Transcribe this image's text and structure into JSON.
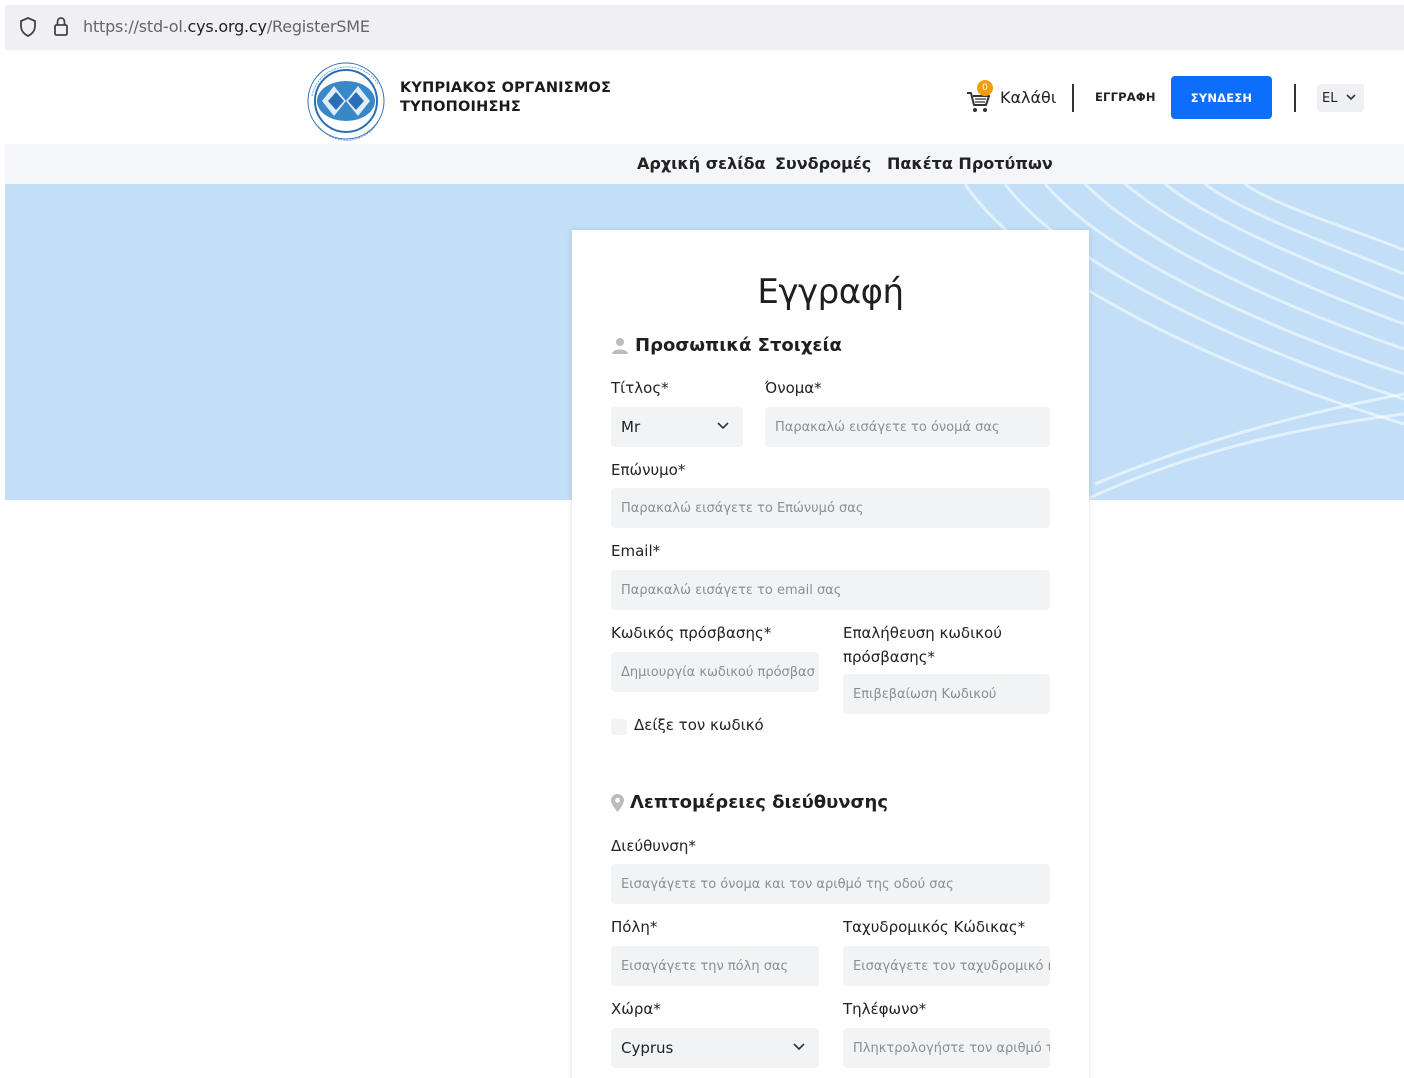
{
  "browser": {
    "url_prefix": "https://std-ol.",
    "url_domain": "cys.org.cy",
    "url_path": "/RegisterSME"
  },
  "header": {
    "brand_line1": "ΚΥΠΡΙΑΚΟΣ ΟΡΓΑΝΙΣΜΟΣ",
    "brand_line2": "ΤΥΠΟΠΟΙΗΣΗΣ",
    "cart_count": "0",
    "cart_label": "Καλάθι",
    "register_label": "ΕΓΓΡΑΦΗ",
    "login_label": "ΣΥΝΔΕΣΗ",
    "language": "EL"
  },
  "nav": {
    "items": [
      "Αρχική σελίδα",
      "Συνδρομές",
      "Πακέτα Προτύπων"
    ]
  },
  "form": {
    "title": "Εγγραφή",
    "personal_section": "Προσωπικά Στοιχεία",
    "title_label": "Τίτλος*",
    "title_value": "Mr",
    "first_name_label": "Όνομα*",
    "first_name_placeholder": "Παρακαλώ εισάγετε το όνομά σας",
    "last_name_label": "Επώνυμο*",
    "last_name_placeholder": "Παρακαλώ εισάγετε το Επώνυμό σας",
    "email_label": "Email*",
    "email_placeholder": "Παρακαλώ εισάγετε το email σας",
    "password_label": "Κωδικός πρόσβασης*",
    "password_placeholder": "Δημιουργία κωδικού πρόσβασ",
    "confirm_label": "Επαλήθευση κωδικού πρόσβασης*",
    "confirm_placeholder": "Επιβεβαίωση Κωδικού",
    "show_password_label": "Δείξε τον κωδικό",
    "address_section": "Λεπτομέρειες διεύθυνσης",
    "address_label": "Διεύθυνση*",
    "address_placeholder": "Εισαγάγετε το όνομα και τον αριθμό της οδού σας",
    "city_label": "Πόλη*",
    "city_placeholder": "Εισαγάγετε την πόλη σας",
    "postal_label": "Ταχυδρομικός Κώδικας*",
    "postal_placeholder": "Εισαγάγετε τον ταχυδρομικό κ",
    "country_label": "Χώρα*",
    "country_value": "Cyprus",
    "phone_label": "Τηλέφωνο*",
    "phone_placeholder": "Πληκτρολογήστε τον αριθμό τ"
  },
  "colors": {
    "accent": "#0d6efd",
    "hero": "#c2dff7",
    "badge": "#f39c12"
  }
}
